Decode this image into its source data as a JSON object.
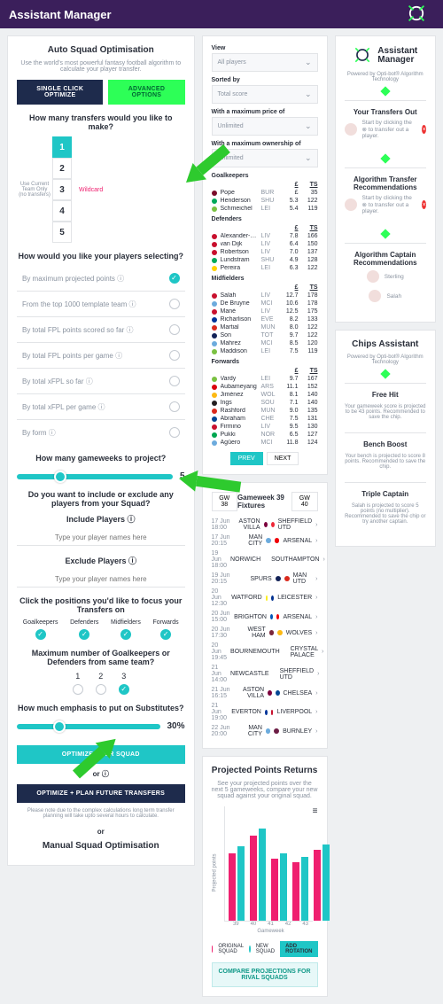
{
  "header": {
    "title": "Assistant Manager"
  },
  "auto": {
    "title": "Auto Squad Optimisation",
    "sub": "Use the world's most powerful fantasy football algorithm to calculate your player transfer.",
    "btn_single": "SINGLE CLICK OPTIMIZE",
    "btn_adv": "ADVANCED OPTIONS",
    "transfers_q": "How many transfers would you like to make?",
    "transfers_note": "Use Current Team Only (no transfers)",
    "transfers_wildcard": "Wildcard",
    "transfers_vals": [
      "1",
      "2",
      "3",
      "4",
      "5"
    ],
    "selecting_q": "How would you like your players selecting?",
    "selecting": [
      "By maximum projected points ⓘ",
      "From the top 1000 template team ⓘ",
      "By total FPL points scored so far ⓘ",
      "By total FPL points per game ⓘ",
      "By total xFPL so far ⓘ",
      "By total xFPL per game ⓘ",
      "By form ⓘ"
    ],
    "gw_q": "How many gameweeks to project?",
    "gw_val": "5",
    "inc_exc_q": "Do you want to include or exclude any players from your Squad?",
    "include_lbl": "Include Players ⓘ",
    "exclude_lbl": "Exclude Players ⓘ",
    "placeholder_players": "Type your player names here",
    "positions_q": "Click the positions you'd like to focus your Transfers on",
    "positions": [
      "Goalkeepers",
      "Defenders",
      "Midfielders",
      "Forwards"
    ],
    "max_def_q": "Maximum number of Goalkeepers or Defenders from same team?",
    "max_def_vals": [
      "1",
      "2",
      "3"
    ],
    "subs_q": "How much emphasis to put on Substitutes?",
    "subs_val": "30%",
    "btn_opt": "OPTIMIZE YOUR SQUAD",
    "btn_plan": "OPTIMIZE + PLAN FUTURE TRANSFERS",
    "plan_note": "Please note due to the complex calculations long term transfer planning will take upto several hours to calculate.",
    "or": "or ⓘ",
    "or2": "or",
    "manual_title": "Manual Squad Optimisation"
  },
  "filters": {
    "view_lbl": "View",
    "view_val": "All players",
    "sort_lbl": "Sorted by",
    "sort_val": "Total score",
    "price_lbl": "With a maximum price of",
    "price_val": "Unlimited",
    "own_lbl": "With a maximum ownership of",
    "own_val": "Unlimited"
  },
  "players": {
    "groups": [
      {
        "h": "Goalkeepers",
        "rows": [
          {
            "c": "#7a0d2a",
            "n": "Pope",
            "t": "BUR",
            "p": "£",
            "s": "35"
          },
          {
            "c": "#00a859",
            "n": "Henderson",
            "t": "SHU",
            "p": "5.3",
            "s": "122"
          },
          {
            "c": "#7ac142",
            "n": "Schmeichel",
            "t": "LEI",
            "p": "5.4",
            "s": "119"
          }
        ]
      },
      {
        "h": "Defenders",
        "rows": [
          {
            "c": "#c8102e",
            "n": "Alexander-Arnold",
            "t": "LIV",
            "p": "7.8",
            "s": "166"
          },
          {
            "c": "#c8102e",
            "n": "van Dijk",
            "t": "LIV",
            "p": "6.4",
            "s": "150"
          },
          {
            "c": "#c8102e",
            "n": "Robertson",
            "t": "LIV",
            "p": "7.0",
            "s": "137"
          },
          {
            "c": "#00a859",
            "n": "Lundstram",
            "t": "SHU",
            "p": "4.9",
            "s": "128"
          },
          {
            "c": "#ffd200",
            "n": "Pereira",
            "t": "LEI",
            "p": "6.3",
            "s": "122"
          }
        ]
      },
      {
        "h": "Midfielders",
        "rows": [
          {
            "c": "#c8102e",
            "n": "Salah",
            "t": "LIV",
            "p": "12.7",
            "s": "178"
          },
          {
            "c": "#6cabdd",
            "n": "De Bruyne",
            "t": "MCI",
            "p": "10.6",
            "s": "178"
          },
          {
            "c": "#c8102e",
            "n": "Mané",
            "t": "LIV",
            "p": "12.5",
            "s": "175"
          },
          {
            "c": "#003399",
            "n": "Richarlison",
            "t": "EVE",
            "p": "8.2",
            "s": "133"
          },
          {
            "c": "#da291c",
            "n": "Martial",
            "t": "MUN",
            "p": "8.0",
            "s": "122"
          },
          {
            "c": "#132257",
            "n": "Son",
            "t": "TOT",
            "p": "9.7",
            "s": "122"
          },
          {
            "c": "#6cabdd",
            "n": "Mahrez",
            "t": "MCI",
            "p": "8.5",
            "s": "120"
          },
          {
            "c": "#7ac142",
            "n": "Maddison",
            "t": "LEI",
            "p": "7.5",
            "s": "119"
          }
        ]
      },
      {
        "h": "Forwards",
        "rows": [
          {
            "c": "#7ac142",
            "n": "Vardy",
            "t": "LEI",
            "p": "9.7",
            "s": "167"
          },
          {
            "c": "#da020e",
            "n": "Aubameyang",
            "t": "ARS",
            "p": "11.1",
            "s": "152"
          },
          {
            "c": "#fdb913",
            "n": "Jiménez",
            "t": "WOL",
            "p": "8.1",
            "s": "140"
          },
          {
            "c": "#241f20",
            "n": "Ings",
            "t": "SOU",
            "p": "7.1",
            "s": "140"
          },
          {
            "c": "#da291c",
            "n": "Rashford",
            "t": "MUN",
            "p": "9.0",
            "s": "135"
          },
          {
            "c": "#034694",
            "n": "Abraham",
            "t": "CHE",
            "p": "7.5",
            "s": "131"
          },
          {
            "c": "#c8102e",
            "n": "Firmino",
            "t": "LIV",
            "p": "9.5",
            "s": "130"
          },
          {
            "c": "#00a650",
            "n": "Pukki",
            "t": "NOR",
            "p": "6.5",
            "s": "127"
          },
          {
            "c": "#6cabdd",
            "n": "Agüero",
            "t": "MCI",
            "p": "11.8",
            "s": "124"
          }
        ]
      }
    ],
    "thead": {
      "p": "£",
      "s": "TS"
    },
    "prev": "PREV",
    "next": "NEXT"
  },
  "fixtures": {
    "title": "Gameweek 39 Fixtures",
    "prev": "GW 38",
    "next": "GW 40",
    "rows": [
      {
        "dt": "17 Jun 18:00",
        "h": "ASTON VILLA",
        "a": "SHEFFIELD UTD",
        "hc": "#7b003c",
        "ac": "#ee2737"
      },
      {
        "dt": "17 Jun 20:15",
        "h": "MAN CITY",
        "a": "ARSENAL",
        "hc": "#6cabdd",
        "ac": "#ef0107"
      },
      {
        "dt": "19 Jun 18:00",
        "h": "NORWICH",
        "a": "SOUTHAMPTON",
        "hc": "#00a650",
        "ac": "#d71920"
      },
      {
        "dt": "19 Jun 20:15",
        "h": "SPURS",
        "a": "MAN UTD",
        "hc": "#132257",
        "ac": "#da291c"
      },
      {
        "dt": "20 Jun 12:30",
        "h": "WATFORD",
        "a": "LEICESTER",
        "hc": "#fbee23",
        "ac": "#003090"
      },
      {
        "dt": "20 Jun 15:00",
        "h": "BRIGHTON",
        "a": "ARSENAL",
        "hc": "#0057b8",
        "ac": "#ef0107"
      },
      {
        "dt": "20 Jun 17:30",
        "h": "WEST HAM",
        "a": "WOLVES",
        "hc": "#7a263a",
        "ac": "#fdb913"
      },
      {
        "dt": "20 Jun 19:45",
        "h": "BOURNEMOUTH",
        "a": "CRYSTAL PALACE",
        "hc": "#da291c",
        "ac": "#1b458f"
      },
      {
        "dt": "21 Jun 14:00",
        "h": "NEWCASTLE",
        "a": "SHEFFIELD UTD",
        "hc": "#241f20",
        "ac": "#ee2737"
      },
      {
        "dt": "21 Jun 16:15",
        "h": "ASTON VILLA",
        "a": "CHELSEA",
        "hc": "#7b003c",
        "ac": "#034694"
      },
      {
        "dt": "21 Jun 19:00",
        "h": "EVERTON",
        "a": "LIVERPOOL",
        "hc": "#003399",
        "ac": "#c8102e"
      },
      {
        "dt": "22 Jun 20:00",
        "h": "MAN CITY",
        "a": "BURNLEY",
        "hc": "#6cabdd",
        "ac": "#6c1d45"
      }
    ]
  },
  "chart_data": {
    "type": "bar",
    "title": "Projected Points Returns",
    "sub": "See your projected points over the next 5 gameweeks, compare your new squad against your original squad.",
    "xlabel": "Gameweek",
    "ylabel": "Projected points",
    "categories": [
      "39",
      "40",
      "41",
      "42",
      "43"
    ],
    "series": [
      {
        "name": "ORIGINAL SQUAD",
        "color": "#ef1f6f",
        "values": [
          38,
          48,
          35,
          33,
          40
        ]
      },
      {
        "name": "NEW SQUAD",
        "color": "#1fc6c6",
        "values": [
          42,
          52,
          38,
          36,
          43
        ]
      }
    ],
    "ylim": [
      0,
      60
    ],
    "rotation_btn": "ADD ROTATION",
    "compare_btn": "COMPARE PROJECTIONS FOR RIVAL SQUADS"
  },
  "assistant": {
    "title_top": "Assistant",
    "title_bot": "Manager",
    "powered": "Powered by Opti-bot® Algorithm Technology",
    "out_h": "Your Transfers Out",
    "out_msg": "Start by clicking the ⊗ to transfer out a player.",
    "algo_h": "Algorithm Transfer Recommendations",
    "algo_msg": "Start by clicking the ⊗ to transfer out a player.",
    "cap_h": "Algorithm Captain Recommendations",
    "cap1": "Sterling",
    "cap2": "Salah",
    "chips_title": "Chips Assistant",
    "chips_sub": "Powered by Opti-bot® Algorithm Technology",
    "fh_h": "Free Hit",
    "fh_msg": "Your gameweek score is projected to be 43 points. Recommended to save the chip.",
    "bb_h": "Bench Boost",
    "bb_msg": "Your bench is projected to score 8 points. Recommended to save the chip.",
    "tc_h": "Triple Captain",
    "tc_msg": "Salah is projected to score 5 points (no multiplier). Recommended to save the chip or try another captain."
  }
}
